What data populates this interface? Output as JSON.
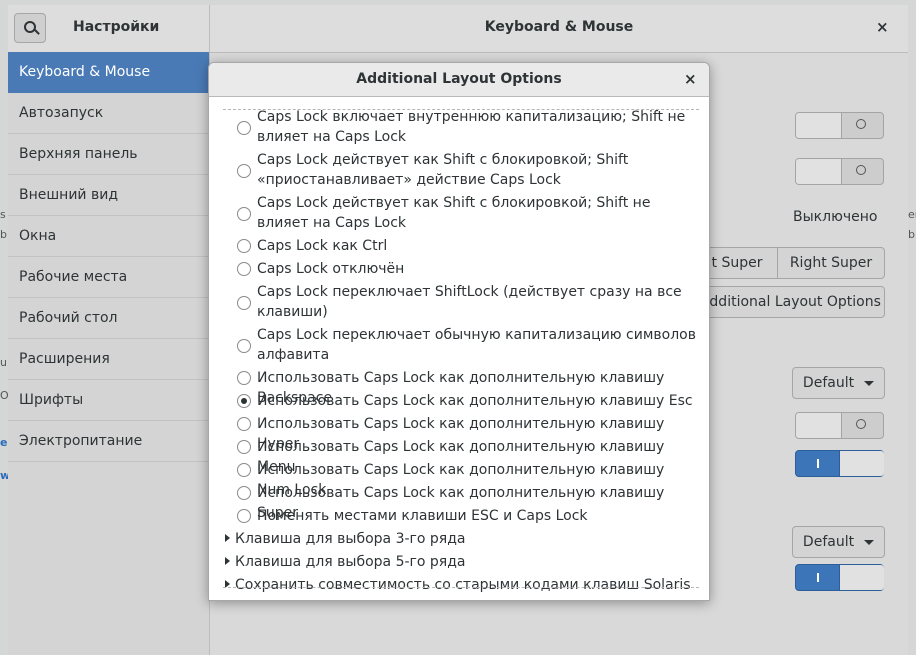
{
  "window": {
    "app_title": "Настройки",
    "title": "Keyboard & Mouse",
    "close_symbol": "×"
  },
  "background_peek": {
    "left_text_1": "s",
    "left_text_2": "b",
    "left_text_3": "u,",
    "left_text_4": "O",
    "left_text_5": "e,",
    "left_text_6": "w",
    "right_text_1": "eri",
    "right_text_2": "b"
  },
  "sidebar": {
    "items": [
      {
        "label": "Keyboard & Mouse"
      },
      {
        "label": "Автозапуск"
      },
      {
        "label": "Верхняя панель"
      },
      {
        "label": "Внешний вид"
      },
      {
        "label": "Окна"
      },
      {
        "label": "Рабочие места"
      },
      {
        "label": "Рабочий стол"
      },
      {
        "label": "Расширения"
      },
      {
        "label": "Шрифты"
      },
      {
        "label": "Электропитание"
      }
    ]
  },
  "content": {
    "off_label": "Выключено",
    "left_super": "t Super",
    "right_super": "Right Super",
    "additional_layout_button": "Additional Layout Options",
    "dropdown_1": "Default",
    "dropdown_2": "Default"
  },
  "dialog": {
    "title": "Additional Layout Options",
    "close_symbol": "×",
    "options": [
      {
        "label": "Caps Lock включает внутреннюю капитализацию; Shift не влияет на Caps Lock",
        "checked": false
      },
      {
        "label": "Caps Lock действует как Shift с блокировкой; Shift «приостанавливает» действие Caps Lock",
        "checked": false
      },
      {
        "label": "Caps Lock действует как Shift с блокировкой; Shift не влияет на Caps Lock",
        "checked": false
      },
      {
        "label": "Caps Lock как Ctrl",
        "checked": false
      },
      {
        "label": "Caps Lock отключён",
        "checked": false
      },
      {
        "label": "Caps Lock переключает ShiftLock (действует сразу на все клавиши)",
        "checked": false
      },
      {
        "label": "Caps Lock переключает обычную капитализацию символов алфавита",
        "checked": false
      },
      {
        "label": "Использовать Caps Lock как дополнительную клавишу Backspace",
        "checked": false
      },
      {
        "label": "Использовать Caps Lock как дополнительную клавишу Esc",
        "checked": true
      },
      {
        "label": "Использовать Caps Lock как дополнительную клавишу Hyper",
        "checked": false
      },
      {
        "label": "Использовать Caps Lock как дополнительную клавишу Menu",
        "checked": false
      },
      {
        "label": "Использовать Caps Lock как дополнительную клавишу Num Lock",
        "checked": false
      },
      {
        "label": "Использовать Caps Lock как дополнительную клавишу Super",
        "checked": false
      },
      {
        "label": "Поменять местами клавиши ESC и Caps Lock",
        "checked": false
      }
    ],
    "groups": [
      {
        "label": "Клавиша для выбора 3-го ряда"
      },
      {
        "label": "Клавиша для выбора 5-го ряда"
      },
      {
        "label": "Сохранить совместимость со старыми кодами клавиш Solaris"
      }
    ]
  },
  "colors": {
    "accent": "#4a7ab6",
    "switch_on": "#3c76b9"
  }
}
